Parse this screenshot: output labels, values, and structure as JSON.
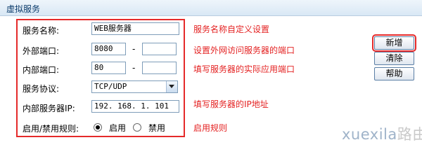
{
  "header": {
    "title": "虚拟服务"
  },
  "form": {
    "service_name": {
      "label": "服务名称:",
      "value": "WEB服务器"
    },
    "external_port": {
      "label": "外部端口:",
      "value": "8080",
      "separator": "-",
      "end_value": ""
    },
    "internal_port": {
      "label": "内部端口:",
      "value": "80",
      "separator": "-",
      "end_value": ""
    },
    "protocol": {
      "label": "服务协议:",
      "value": "TCP/UDP"
    },
    "server_ip": {
      "label": "内部服务器IP:",
      "value": "192. 168. 1. 101"
    },
    "rule": {
      "label": "启用/禁用规则:",
      "options": [
        "启用",
        "禁用"
      ],
      "selected": "启用"
    }
  },
  "notes": {
    "service_name": "服务名称自定义设置",
    "external_port": "设置外网访问服务器的端口",
    "internal_port": "填写服务器的实际应用端口",
    "server_ip": "填写服务器的IP地址",
    "rule": "启用规则"
  },
  "buttons": {
    "add": "新增",
    "clear": "清除",
    "help": "帮助"
  },
  "watermark": {
    "part1": "xuexila",
    "part2": "路由网"
  },
  "colors": {
    "highlight": "#e52a2a",
    "note_text": "#e42222"
  }
}
